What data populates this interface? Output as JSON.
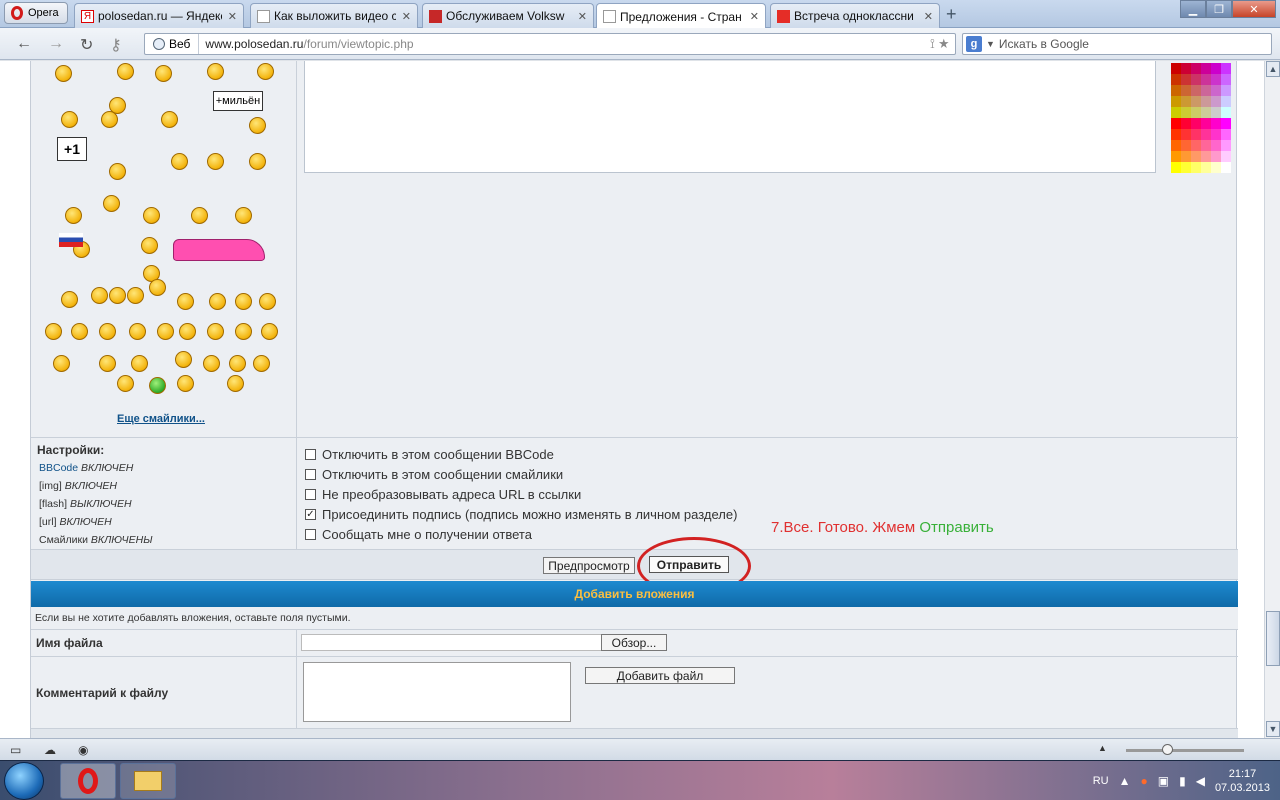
{
  "browser": {
    "menu_label": "Opera",
    "tabs": [
      {
        "label": "polosedan.ru — Яндекс",
        "active": false
      },
      {
        "label": "Как выложить видео с",
        "active": false
      },
      {
        "label": "Обслуживаем Volksw",
        "active": false
      },
      {
        "label": "Предложения - Стран",
        "active": true
      },
      {
        "label": "Встреча одноклассни",
        "active": false
      }
    ],
    "new_tab": "+",
    "address": {
      "scope_label": "Веб",
      "domain": "www.polosedan.ru",
      "path": "/forum/viewtopic.php"
    },
    "search_placeholder": "Искать в Google"
  },
  "smilies": {
    "more_link": "Еще смайлики..."
  },
  "settings": {
    "heading": "Настройки:",
    "items": [
      {
        "name": "BBCode",
        "state": "ВКЛЮЧЕН"
      },
      {
        "name": "[img]",
        "state": "ВКЛЮЧЕН"
      },
      {
        "name": "[flash]",
        "state": "ВЫКЛЮЧЕН"
      },
      {
        "name": "[url]",
        "state": "ВКЛЮЧЕН"
      },
      {
        "name": "Смайлики",
        "state": "ВКЛЮЧЕНЫ"
      }
    ]
  },
  "options": [
    {
      "label": "Отключить в этом сообщении BBCode",
      "checked": false
    },
    {
      "label": "Отключить в этом сообщении смайлики",
      "checked": false
    },
    {
      "label": "Не преобразовывать адреса URL в ссылки",
      "checked": false
    },
    {
      "label": "Присоединить подпись (подпись можно изменять в личном разделе)",
      "checked": true
    },
    {
      "label": "Сообщать мне о получении ответа",
      "checked": false
    }
  ],
  "annotation": {
    "text": "7.Все. Готово. Жмем ",
    "highlight": "Отправить",
    "color": "#e03030",
    "highlight_color": "#38b038"
  },
  "buttons": {
    "preview": "Предпросмотр",
    "submit": "Отправить"
  },
  "attachments": {
    "header": "Добавить вложения",
    "note": "Если вы не хотите добавлять вложения, оставьте поля пустыми.",
    "file_label": "Имя файла",
    "browse": "Обзор...",
    "comment_label": "Комментарий к файлу",
    "add_file": "Добавить файл"
  },
  "taskbar": {
    "lang": "RU",
    "time": "21:17",
    "date": "07.03.2013"
  },
  "colors": {
    "header_bg": "#1478bd",
    "header_text": "#fbbf40",
    "link": "#105289"
  }
}
